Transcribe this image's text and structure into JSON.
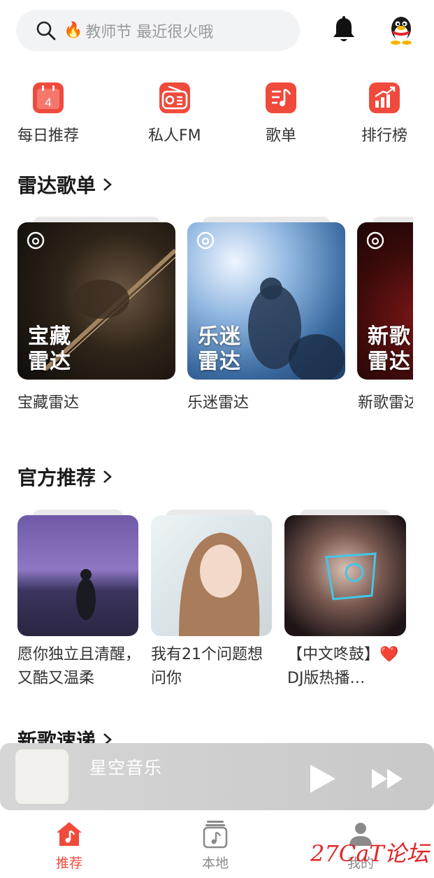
{
  "search": {
    "placeholder": "教师节 最近很火哦"
  },
  "quick_nav": [
    {
      "label": "每日推荐",
      "icon": "calendar-icon",
      "date": "4"
    },
    {
      "label": "私人FM",
      "icon": "radio-icon"
    },
    {
      "label": "歌单",
      "icon": "playlist-icon"
    },
    {
      "label": "排行榜",
      "icon": "chart-icon"
    }
  ],
  "radar": {
    "title": "雷达歌单",
    "items": [
      {
        "line1": "宝藏",
        "line2": "雷达",
        "label": "宝藏雷达"
      },
      {
        "line1": "乐迷",
        "line2": "雷达",
        "label": "乐迷雷达"
      },
      {
        "line1": "新歌",
        "line2": "雷达",
        "label": "新歌雷达"
      }
    ]
  },
  "official": {
    "title": "官方推荐",
    "items": [
      {
        "label": "愿你独立且清醒，又酷又温柔"
      },
      {
        "label": "我有21个问题想问你"
      },
      {
        "label": "【中文咚鼓】❤️DJ版热播…"
      }
    ]
  },
  "new_songs": {
    "title": "新歌速递"
  },
  "player": {
    "title": "星空音乐"
  },
  "bottom_nav": [
    {
      "label": "推荐",
      "icon": "home-icon",
      "active": true
    },
    {
      "label": "本地",
      "icon": "local-music-icon",
      "active": false
    },
    {
      "label": "我的",
      "icon": "profile-icon",
      "active": false
    }
  ],
  "watermark": "27CaT论坛",
  "colors": {
    "accent": "#f04a3c",
    "inactive": "#8a8a8a"
  }
}
